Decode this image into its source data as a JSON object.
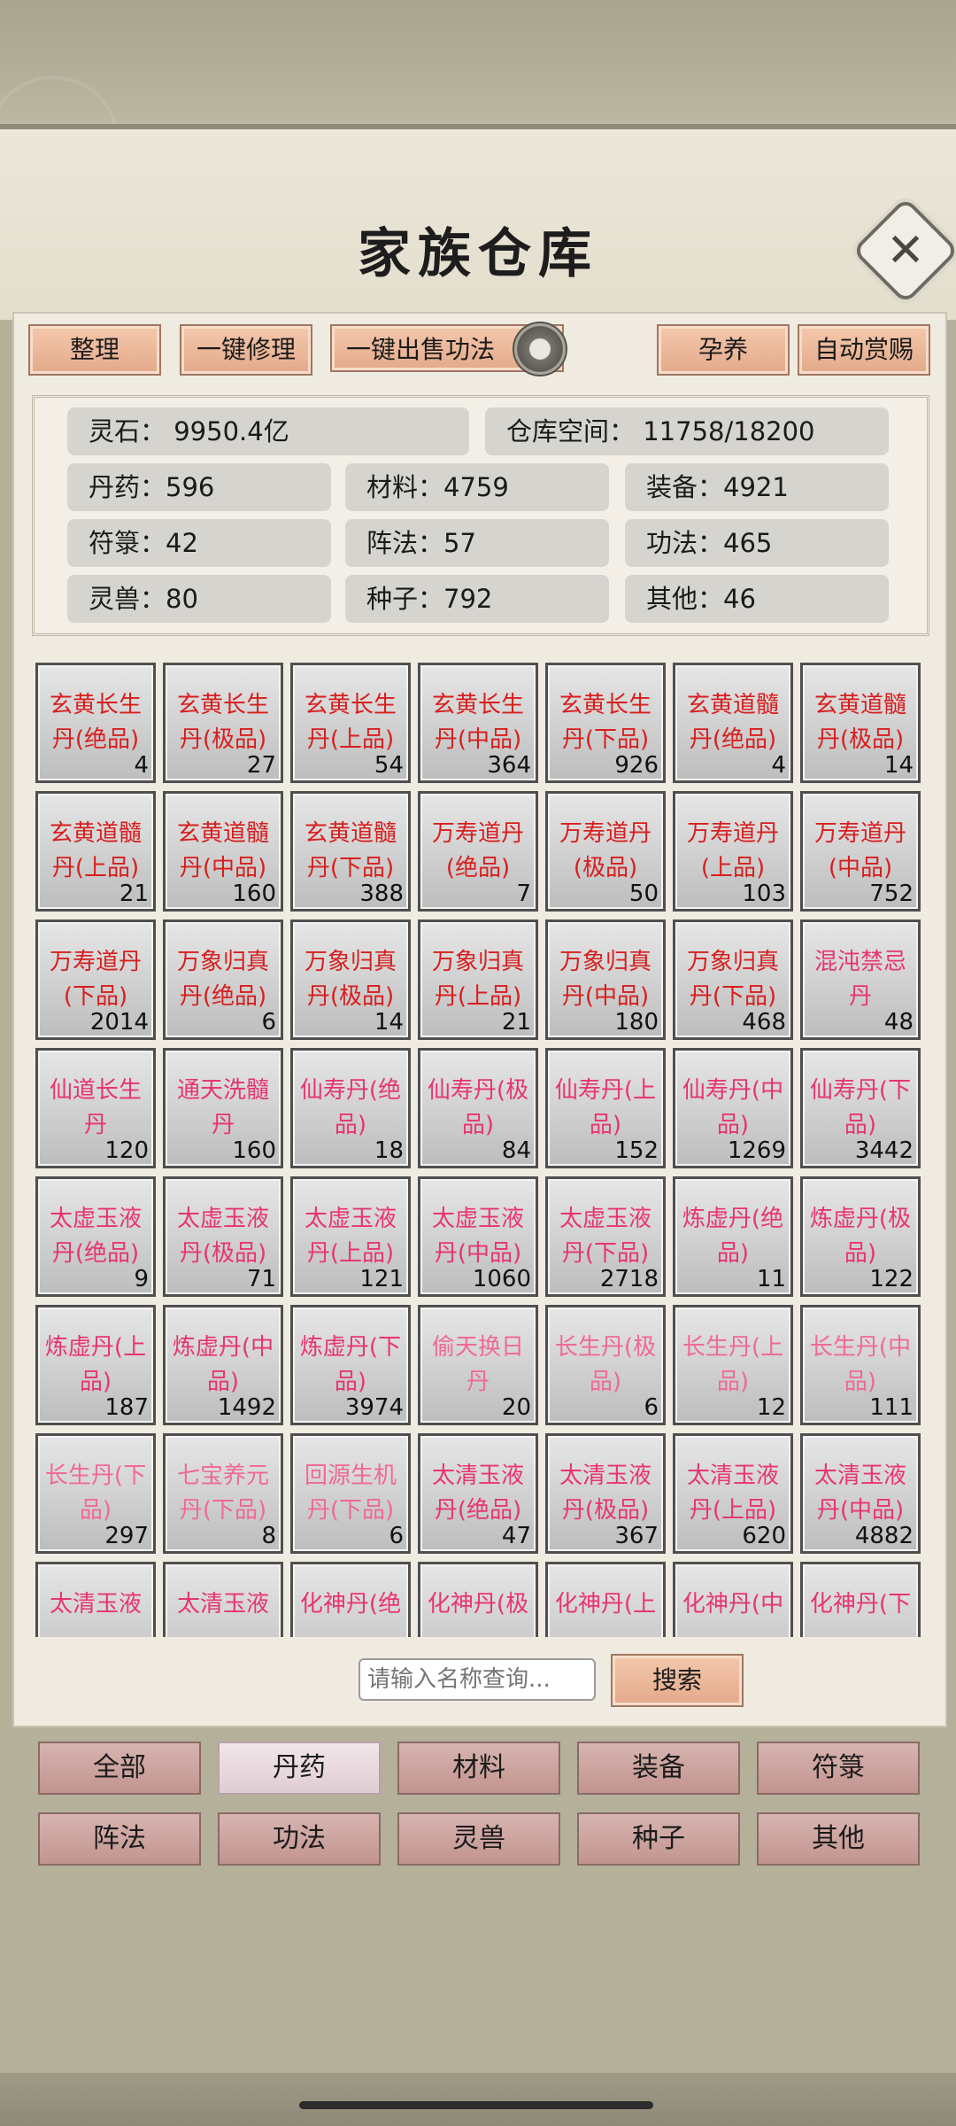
{
  "header": {
    "title": "家族仓库"
  },
  "toolbar": {
    "organize": "整理",
    "repair_all": "一键修理",
    "sell_skills": "一键出售功法",
    "nurture": "孕养",
    "auto_reward": "自动赏赐"
  },
  "stats": {
    "spirit_stone": "灵石： 9950.4亿",
    "storage": "仓库空间：   11758/18200",
    "pills": "丹药：596",
    "materials": "材料：4759",
    "equipment": "装备：4921",
    "talismans": "符箓：42",
    "formations": "阵法：57",
    "skills": "功法：465",
    "beasts": "灵兽：80",
    "seeds": "种子：792",
    "other": "其他：46"
  },
  "colors": {
    "red": "#d81e1e",
    "pink": "#e8356e",
    "lightpink": "#f06a93"
  },
  "items": [
    {
      "name": "玄黄长生丹(绝品)",
      "count": "4",
      "color": "red"
    },
    {
      "name": "玄黄长生丹(极品)",
      "count": "27",
      "color": "red"
    },
    {
      "name": "玄黄长生丹(上品)",
      "count": "54",
      "color": "red"
    },
    {
      "name": "玄黄长生丹(中品)",
      "count": "364",
      "color": "red"
    },
    {
      "name": "玄黄长生丹(下品)",
      "count": "926",
      "color": "red"
    },
    {
      "name": "玄黄道髓丹(绝品)",
      "count": "4",
      "color": "red"
    },
    {
      "name": "玄黄道髓丹(极品)",
      "count": "14",
      "color": "red"
    },
    {
      "name": "玄黄道髓丹(上品)",
      "count": "21",
      "color": "red"
    },
    {
      "name": "玄黄道髓丹(中品)",
      "count": "160",
      "color": "red"
    },
    {
      "name": "玄黄道髓丹(下品)",
      "count": "388",
      "color": "red"
    },
    {
      "name": "万寿道丹(绝品)",
      "count": "7",
      "color": "red"
    },
    {
      "name": "万寿道丹(极品)",
      "count": "50",
      "color": "red"
    },
    {
      "name": "万寿道丹(上品)",
      "count": "103",
      "color": "red"
    },
    {
      "name": "万寿道丹(中品)",
      "count": "752",
      "color": "red"
    },
    {
      "name": "万寿道丹(下品)",
      "count": "2014",
      "color": "red"
    },
    {
      "name": "万象归真丹(绝品)",
      "count": "6",
      "color": "red"
    },
    {
      "name": "万象归真丹(极品)",
      "count": "14",
      "color": "red"
    },
    {
      "name": "万象归真丹(上品)",
      "count": "21",
      "color": "red"
    },
    {
      "name": "万象归真丹(中品)",
      "count": "180",
      "color": "red"
    },
    {
      "name": "万象归真丹(下品)",
      "count": "468",
      "color": "red"
    },
    {
      "name": "混沌禁忌丹",
      "count": "48",
      "color": "pink"
    },
    {
      "name": "仙道长生丹",
      "count": "120",
      "color": "pink"
    },
    {
      "name": "通天洗髓丹",
      "count": "160",
      "color": "pink"
    },
    {
      "name": "仙寿丹(绝品)",
      "count": "18",
      "color": "pink"
    },
    {
      "name": "仙寿丹(极品)",
      "count": "84",
      "color": "pink"
    },
    {
      "name": "仙寿丹(上品)",
      "count": "152",
      "color": "pink"
    },
    {
      "name": "仙寿丹(中品)",
      "count": "1269",
      "color": "pink"
    },
    {
      "name": "仙寿丹(下品)",
      "count": "3442",
      "color": "pink"
    },
    {
      "name": "太虚玉液丹(绝品)",
      "count": "9",
      "color": "pink"
    },
    {
      "name": "太虚玉液丹(极品)",
      "count": "71",
      "color": "pink"
    },
    {
      "name": "太虚玉液丹(上品)",
      "count": "121",
      "color": "pink"
    },
    {
      "name": "太虚玉液丹(中品)",
      "count": "1060",
      "color": "pink"
    },
    {
      "name": "太虚玉液丹(下品)",
      "count": "2718",
      "color": "pink"
    },
    {
      "name": "炼虚丹(绝品)",
      "count": "11",
      "color": "pink"
    },
    {
      "name": "炼虚丹(极品)",
      "count": "122",
      "color": "pink"
    },
    {
      "name": "炼虚丹(上品)",
      "count": "187",
      "color": "pink"
    },
    {
      "name": "炼虚丹(中品)",
      "count": "1492",
      "color": "pink"
    },
    {
      "name": "炼虚丹(下品)",
      "count": "3974",
      "color": "pink"
    },
    {
      "name": "偷天换日丹",
      "count": "20",
      "color": "lightpink"
    },
    {
      "name": "长生丹(极品)",
      "count": "6",
      "color": "lightpink"
    },
    {
      "name": "长生丹(上品)",
      "count": "12",
      "color": "lightpink"
    },
    {
      "name": "长生丹(中品)",
      "count": "111",
      "color": "lightpink"
    },
    {
      "name": "长生丹(下品)",
      "count": "297",
      "color": "lightpink"
    },
    {
      "name": "七宝养元丹(下品)",
      "count": "8",
      "color": "lightpink"
    },
    {
      "name": "回源生机丹(下品)",
      "count": "6",
      "color": "lightpink"
    },
    {
      "name": "太清玉液丹(绝品)",
      "count": "47",
      "color": "pink"
    },
    {
      "name": "太清玉液丹(极品)",
      "count": "367",
      "color": "pink"
    },
    {
      "name": "太清玉液丹(上品)",
      "count": "620",
      "color": "pink"
    },
    {
      "name": "太清玉液丹(中品)",
      "count": "4882",
      "color": "pink"
    },
    {
      "name": "太清玉液",
      "count": "",
      "color": "pink"
    },
    {
      "name": "太清玉液",
      "count": "",
      "color": "pink"
    },
    {
      "name": "化神丹(绝",
      "count": "",
      "color": "pink"
    },
    {
      "name": "化神丹(极",
      "count": "",
      "color": "pink"
    },
    {
      "name": "化神丹(上",
      "count": "",
      "color": "pink"
    },
    {
      "name": "化神丹(中",
      "count": "",
      "color": "pink"
    },
    {
      "name": "化神丹(下",
      "count": "",
      "color": "pink"
    }
  ],
  "search": {
    "placeholder": "请输入名称查询...",
    "button": "搜索"
  },
  "tabs": [
    "全部",
    "丹药",
    "材料",
    "装备",
    "符箓",
    "阵法",
    "功法",
    "灵兽",
    "种子",
    "其他"
  ],
  "active_tab": "丹药"
}
